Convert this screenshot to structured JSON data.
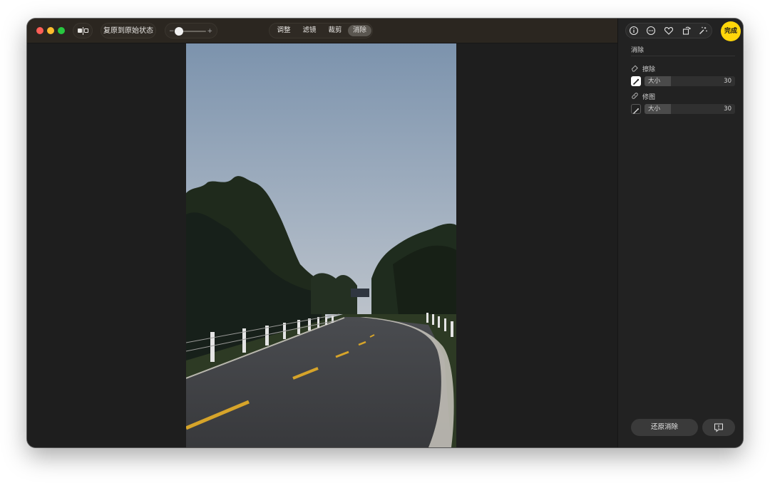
{
  "toolbar": {
    "revert_label": "复原到原始状态",
    "zoom_minus": "−",
    "zoom_plus": "+",
    "zoom_level": 0.03,
    "tabs": [
      {
        "label": "调整",
        "active": false
      },
      {
        "label": "滤镜",
        "active": false
      },
      {
        "label": "裁剪",
        "active": false
      },
      {
        "label": "消除",
        "active": true
      }
    ]
  },
  "sidebar": {
    "top_icons": [
      "info-icon",
      "more-icon",
      "heart-icon",
      "rotate-icon",
      "magic-wand-icon"
    ],
    "done_label": "完成",
    "section_title": "消除",
    "tools": [
      {
        "name": "擦除",
        "icon": "eraser-icon",
        "size_label": "大小",
        "size_value": "30",
        "brush_active": true
      },
      {
        "name": "修图",
        "icon": "bandage-icon",
        "size_label": "大小",
        "size_value": "30",
        "brush_active": false
      }
    ],
    "restore_label": "还原消除",
    "feedback_icon": "feedback-icon"
  },
  "colors": {
    "accent": "#ffd60a",
    "window_bg": "#1e1e1e",
    "toolbar_bg": "#2b2620",
    "sidebar_bg": "#222222"
  }
}
